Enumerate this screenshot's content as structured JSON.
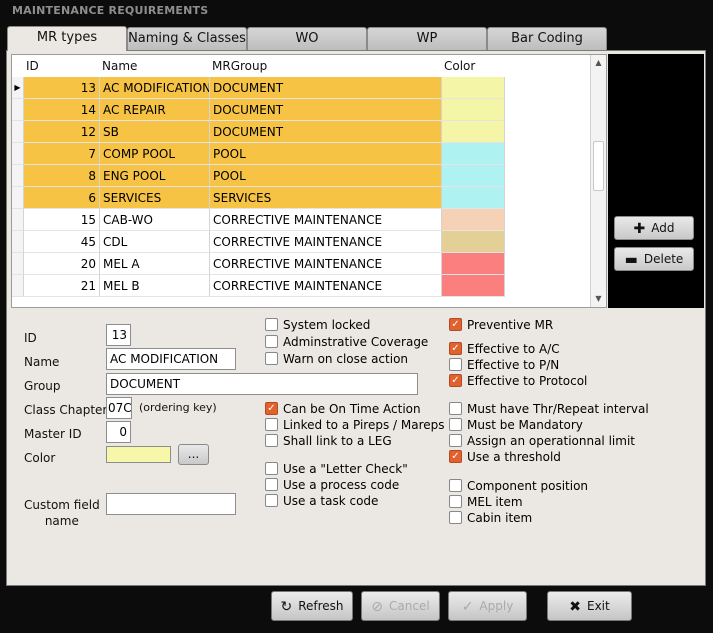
{
  "window": {
    "title": "MAINTENANCE REQUIREMENTS"
  },
  "tabs": [
    {
      "label": "MR types",
      "active": true
    },
    {
      "label": "Naming & Classes",
      "active": false
    },
    {
      "label": "WO",
      "active": false
    },
    {
      "label": "WP",
      "active": false
    },
    {
      "label": "Bar Coding",
      "active": false
    }
  ],
  "grid": {
    "columns": [
      "ID",
      "Name",
      "MRGroup",
      "Color"
    ],
    "rows": [
      {
        "id": "13",
        "name": "AC MODIFICATION",
        "group": "DOCUMENT",
        "color": "#f5f5a8",
        "bg": "#f6c344",
        "current": true
      },
      {
        "id": "14",
        "name": "AC REPAIR",
        "group": "DOCUMENT",
        "color": "#f5f5a8",
        "bg": "#f6c344",
        "current": false
      },
      {
        "id": "12",
        "name": "SB",
        "group": "DOCUMENT",
        "color": "#f5f5a8",
        "bg": "#f6c344",
        "current": false
      },
      {
        "id": "7",
        "name": "COMP POOL",
        "group": "POOL",
        "color": "#aef2f2",
        "bg": "#f6c344",
        "current": false
      },
      {
        "id": "8",
        "name": "ENG POOL",
        "group": "POOL",
        "color": "#aef2f2",
        "bg": "#f6c344",
        "current": false
      },
      {
        "id": "6",
        "name": "SERVICES",
        "group": "SERVICES",
        "color": "#aef2f2",
        "bg": "#f6c344",
        "current": false
      },
      {
        "id": "15",
        "name": "CAB-WO",
        "group": "CORRECTIVE MAINTENANCE",
        "color": "#f5d2b5",
        "bg": "#ffffff",
        "current": false
      },
      {
        "id": "45",
        "name": "CDL",
        "group": "CORRECTIVE MAINTENANCE",
        "color": "#e4d096",
        "bg": "#ffffff",
        "current": false
      },
      {
        "id": "20",
        "name": "MEL A",
        "group": "CORRECTIVE MAINTENANCE",
        "color": "#fb7f7f",
        "bg": "#ffffff",
        "current": false
      },
      {
        "id": "21",
        "name": "MEL B",
        "group": "CORRECTIVE MAINTENANCE",
        "color": "#fb7f7f",
        "bg": "#ffffff",
        "current": false
      }
    ],
    "current_marker": "▶"
  },
  "side_buttons": {
    "add": "Add",
    "delete": "Delete"
  },
  "form": {
    "id_label": "ID",
    "id_value": "13",
    "name_label": "Name",
    "name_value": "AC MODIFICATION",
    "group_label": "Group",
    "group_value": "DOCUMENT",
    "class_label": "Class Chapter",
    "class_value": "07C",
    "class_hint": "(ordering key)",
    "master_label": "Master ID",
    "master_value": "0",
    "color_label": "Color",
    "color_value": "#f7f7a9",
    "color_button": "...",
    "custom_label_1": "Custom field",
    "custom_label_2": "name",
    "custom_value": ""
  },
  "checks_mid": [
    {
      "label": "System locked",
      "checked": false
    },
    {
      "label": "Adminstrative Coverage",
      "checked": false
    },
    {
      "label": "Warn on close action",
      "checked": false
    },
    {
      "label": "Can be On Time Action",
      "checked": true
    },
    {
      "label": "Linked to a Pireps / Mareps",
      "checked": false
    },
    {
      "label": "Shall link to a LEG",
      "checked": false
    },
    {
      "label": "Use a \"Letter Check\"",
      "checked": false
    },
    {
      "label": "Use a process code",
      "checked": false
    },
    {
      "label": "Use a task code",
      "checked": false
    }
  ],
  "checks_right": [
    {
      "label": "Preventive MR",
      "checked": true
    },
    {
      "label": "Effective to A/C",
      "checked": true
    },
    {
      "label": "Effective to P/N",
      "checked": false
    },
    {
      "label": "Effective to Protocol",
      "checked": true
    },
    {
      "label": "Must have Thr/Repeat interval",
      "checked": false
    },
    {
      "label": "Must be Mandatory",
      "checked": false
    },
    {
      "label": "Assign an operationnal limit",
      "checked": false
    },
    {
      "label": "Use a threshold",
      "checked": true
    },
    {
      "label": "Component position",
      "checked": false
    },
    {
      "label": "MEL item",
      "checked": false
    },
    {
      "label": "Cabin item",
      "checked": false
    }
  ],
  "bottom": {
    "refresh": "Refresh",
    "cancel": "Cancel",
    "apply": "Apply",
    "exit": "Exit"
  },
  "colors": {
    "checked": "#e2622f",
    "highlight_row": "#f6c344",
    "panel": "#ebe8e3"
  }
}
